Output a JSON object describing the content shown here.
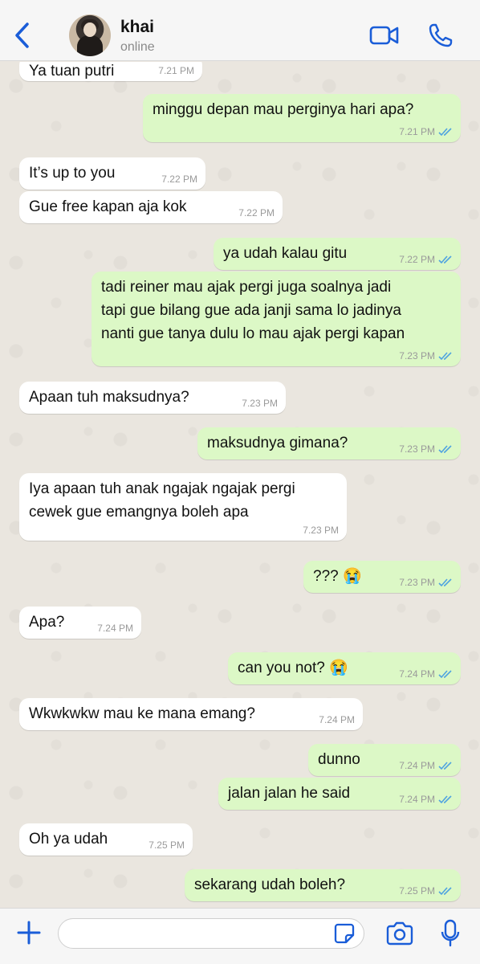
{
  "header": {
    "contact_name": "khai",
    "status": "online"
  },
  "colors": {
    "accent": "#1a5dd8",
    "outgoing_bubble": "#dcf8c6",
    "incoming_bubble": "#ffffff",
    "read_ticks": "#4fa3e0",
    "chat_background": "#eae6df"
  },
  "messages": [
    {
      "dir": "in",
      "text": "Ya tuan putri",
      "time": "7.21 PM"
    },
    {
      "dir": "out",
      "text": "minggu depan mau perginya hari apa?",
      "time": "7.21 PM",
      "read": true
    },
    {
      "dir": "in",
      "text": "It’s up to you",
      "time": "7.22 PM"
    },
    {
      "dir": "in",
      "text": "Gue free kapan aja kok",
      "time": "7.22 PM"
    },
    {
      "dir": "out",
      "text": "ya udah kalau gitu",
      "time": "7.22 PM",
      "read": true
    },
    {
      "dir": "out",
      "text": "tadi reiner mau ajak pergi juga soalnya jadi\ntapi gue bilang gue ada janji sama lo jadinya\nnanti gue tanya dulu lo mau ajak pergi kapan",
      "time": "7.23 PM",
      "read": true
    },
    {
      "dir": "in",
      "text": "Apaan tuh maksudnya?",
      "time": "7.23 PM"
    },
    {
      "dir": "out",
      "text": "maksudnya gimana?",
      "time": "7.23 PM",
      "read": true
    },
    {
      "dir": "in",
      "text": "Iya apaan tuh anak ngajak ngajak pergi\ncewek gue emangnya boleh apa",
      "time": "7.23 PM"
    },
    {
      "dir": "out",
      "text": "??? 😭",
      "time": "7.23 PM",
      "read": true
    },
    {
      "dir": "in",
      "text": "Apa?",
      "time": "7.24 PM"
    },
    {
      "dir": "out",
      "text": "can you not? 😭",
      "time": "7.24 PM",
      "read": true
    },
    {
      "dir": "in",
      "text": "Wkwkwkw mau ke mana emang?",
      "time": "7.24 PM"
    },
    {
      "dir": "out",
      "text": "dunno",
      "time": "7.24 PM",
      "read": true
    },
    {
      "dir": "out",
      "text": "jalan jalan he said",
      "time": "7.24 PM",
      "read": true
    },
    {
      "dir": "in",
      "text": "Oh ya udah",
      "time": "7.25 PM"
    },
    {
      "dir": "out",
      "text": "sekarang udah boleh?",
      "time": "7.25 PM",
      "read": true
    }
  ],
  "input": {
    "value": "",
    "placeholder": ""
  },
  "icons": {
    "back": "chevron-left-icon",
    "video": "video-camera-icon",
    "call": "phone-icon",
    "attach": "plus-icon",
    "sticker": "sticker-icon",
    "camera": "camera-icon",
    "mic": "microphone-icon"
  }
}
